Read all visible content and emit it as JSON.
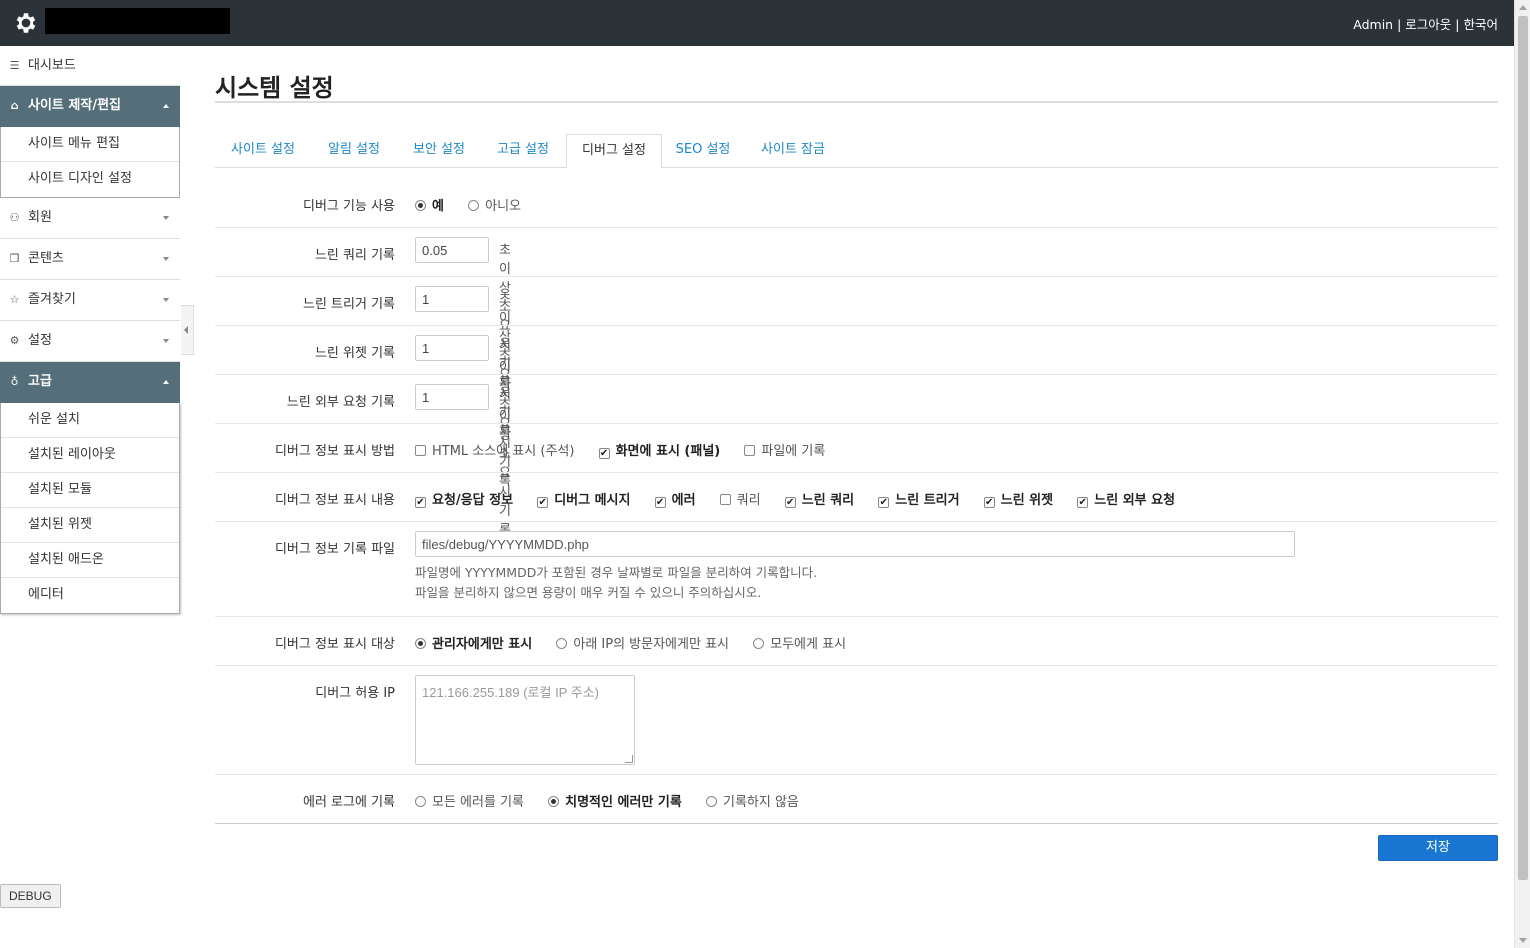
{
  "header": {
    "user": "Admin",
    "separator": "|",
    "logout": "로그아웃",
    "language": "한국어"
  },
  "sidebar": {
    "dashboard": "대시보드",
    "site_build": "사이트 제작/편집",
    "site_build_items": [
      "사이트 메뉴 편집",
      "사이트 디자인 설정"
    ],
    "members": "회원",
    "contents": "콘텐츠",
    "favorites": "즐겨찾기",
    "settings": "설정",
    "advanced": "고급",
    "advanced_items": [
      "쉬운 설치",
      "설치된 레이아웃",
      "설치된 모듈",
      "설치된 위젯",
      "설치된 애드온",
      "에디터"
    ]
  },
  "page": {
    "title": "시스템 설정",
    "tabs": [
      "사이트 설정",
      "알림 설정",
      "보안 설정",
      "고급 설정",
      "디버그 설정",
      "SEO 설정",
      "사이트 잠금"
    ],
    "active_tab": "디버그 설정"
  },
  "form": {
    "debug_enable": {
      "label": "디버그 기능 사용",
      "yes": "예",
      "no": "아니오",
      "selected": "예"
    },
    "slow_query": {
      "label": "느린 쿼리 기록",
      "value": "0.05",
      "hint": "초 이상 소요시 기록"
    },
    "slow_trigger": {
      "label": "느린 트리거 기록",
      "value": "1",
      "hint": "초 이상 소요시 기록"
    },
    "slow_widget": {
      "label": "느린 위젯 기록",
      "value": "1",
      "hint": "초 이상 소요시 기록"
    },
    "slow_remote": {
      "label": "느린 외부 요청 기록",
      "value": "1",
      "hint": "초 이상 소요시 기록"
    },
    "display_method": {
      "label": "디버그 정보 표시 방법",
      "options": [
        {
          "text": "HTML 소스에 표시 (주석)",
          "checked": false
        },
        {
          "text": "화면에 표시 (패널)",
          "checked": true
        },
        {
          "text": "파일에 기록",
          "checked": false
        }
      ]
    },
    "display_content": {
      "label": "디버그 정보 표시 내용",
      "options": [
        {
          "text": "요청/응답 정보",
          "checked": true
        },
        {
          "text": "디버그 메시지",
          "checked": true
        },
        {
          "text": "에러",
          "checked": true
        },
        {
          "text": "쿼리",
          "checked": false
        },
        {
          "text": "느린 쿼리",
          "checked": true
        },
        {
          "text": "느린 트리거",
          "checked": true
        },
        {
          "text": "느린 위젯",
          "checked": true
        },
        {
          "text": "느린 외부 요청",
          "checked": true
        }
      ]
    },
    "log_file": {
      "label": "디버그 정보 기록 파일",
      "value": "files/debug/YYYYMMDD.php",
      "help1": "파일명에 YYYYMMDD가 포함된 경우 날짜별로 파일을 분리하여 기록합니다.",
      "help2": "파일을 분리하지 않으면 용량이 매우 커질 수 있으니 주의하십시오."
    },
    "display_target": {
      "label": "디버그 정보 표시 대상",
      "options": [
        {
          "text": "관리자에게만 표시",
          "checked": true
        },
        {
          "text": "아래 IP의 방문자에게만 표시",
          "checked": false
        },
        {
          "text": "모두에게 표시",
          "checked": false
        }
      ]
    },
    "allowed_ip": {
      "label": "디버그 허용 IP",
      "placeholder": "121.166.255.189 (로컬 IP 주소)"
    },
    "error_log": {
      "label": "에러 로그에 기록",
      "options": [
        {
          "text": "모든 에러를 기록",
          "checked": false
        },
        {
          "text": "치명적인 에러만 기록",
          "checked": true
        },
        {
          "text": "기록하지 않음",
          "checked": false
        }
      ]
    },
    "save": "저장"
  },
  "debug_button": "DEBUG",
  "colors": {
    "header_bg": "#2b3338",
    "sidebar_active": "#546e7a",
    "link": "#1e88c8",
    "primary": "#1976d2"
  }
}
